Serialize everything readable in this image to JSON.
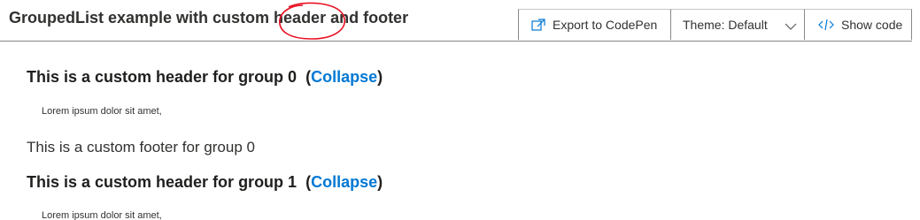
{
  "header": {
    "title": "GroupedList example with custom header and footer",
    "export_label": "Export to CodePen",
    "theme_label": "Theme: Default",
    "show_code_label": "Show code",
    "annotation_color": "#e81123"
  },
  "groups": [
    {
      "header_text": "This is a custom header for group 0",
      "collapse_label": "Collapse",
      "item_text": "Lorem ipsum dolor sit amet,",
      "footer_text": "This is a custom footer for group 0"
    },
    {
      "header_text": "This is a custom header for group 1",
      "collapse_label": "Collapse",
      "item_text": "Lorem ipsum dolor sit amet,"
    }
  ],
  "colors": {
    "link": "#0078d4",
    "text": "#323130"
  },
  "icons": {
    "export": "open-in-new-window-icon",
    "theme": "chevron-down-icon",
    "code": "code-icon"
  }
}
